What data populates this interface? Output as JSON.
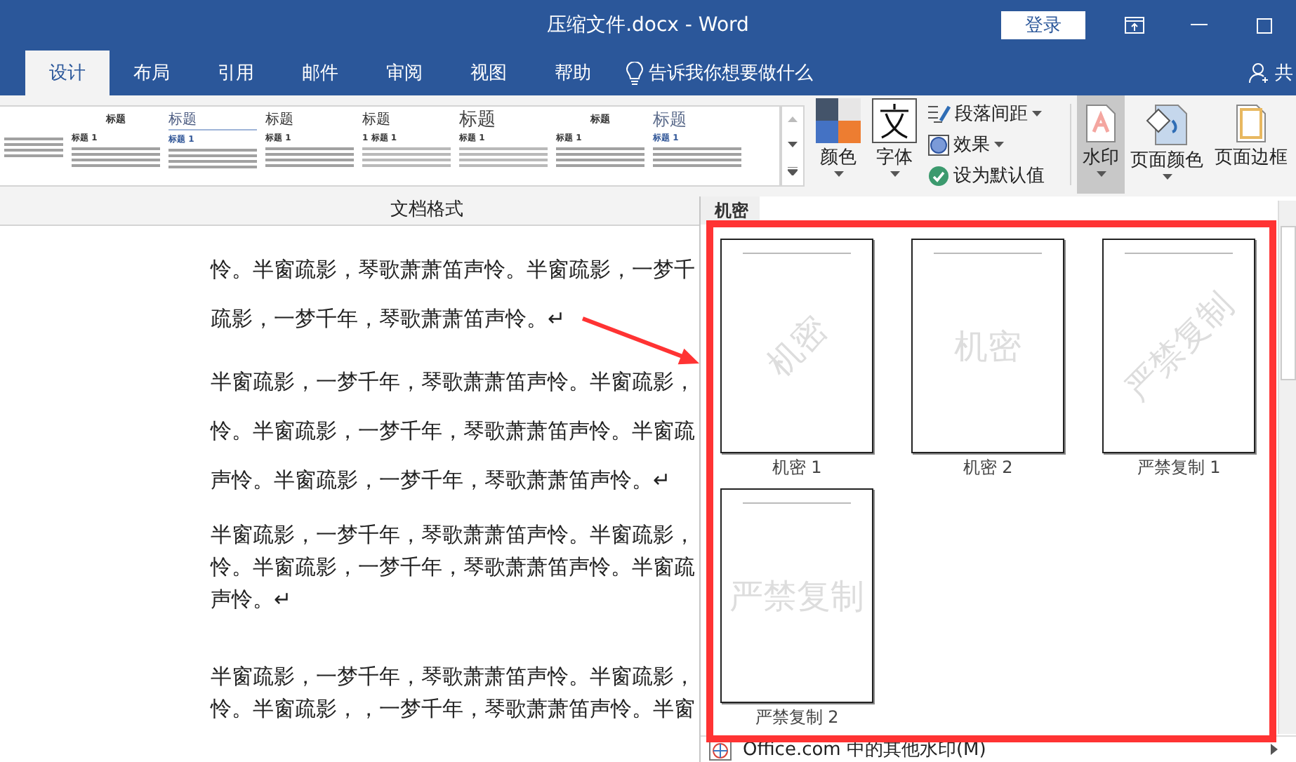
{
  "window": {
    "title": "压缩文件.docx  -  Word",
    "signin": "登录"
  },
  "tabs": [
    {
      "label": "设计",
      "selected": true
    },
    {
      "label": "布局",
      "selected": false
    },
    {
      "label": "引用",
      "selected": false
    },
    {
      "label": "邮件",
      "selected": false
    },
    {
      "label": "审阅",
      "selected": false
    },
    {
      "label": "视图",
      "selected": false
    },
    {
      "label": "帮助",
      "selected": false
    }
  ],
  "tell_me": "告诉我你想要做什么",
  "share": "共",
  "styles": [
    {
      "kind": "plain"
    },
    {
      "kind": "small",
      "title": "标题",
      "heading": "标题 1"
    },
    {
      "kind": "underline",
      "title": "标题",
      "heading": "标题 1"
    },
    {
      "kind": "plain",
      "title": "标题",
      "heading": "标题 1"
    },
    {
      "kind": "numbered",
      "title": "标题",
      "heading": "1  标题 1"
    },
    {
      "kind": "big",
      "title": "标题",
      "heading": "标题 1"
    },
    {
      "kind": "bold",
      "title": "标题",
      "heading": "标题 1"
    },
    {
      "kind": "blue",
      "title": "标题",
      "heading": "标题 1"
    }
  ],
  "ribbon": {
    "colors": "颜色",
    "fonts": "字体",
    "paragraph_spacing": "段落间距",
    "effects": "效果",
    "set_default": "设为默认值",
    "group_label": "文档格式",
    "page_buttons": [
      {
        "kind": "watermark",
        "label": "水印",
        "selected": true
      },
      {
        "kind": "page-color",
        "label": "页面颜色",
        "selected": false
      },
      {
        "kind": "page-border",
        "label": "页面边框",
        "selected": false
      }
    ]
  },
  "document": {
    "paragraphs": [
      {
        "kind": "wide",
        "lines": [
          "怜。半窗疏影，琴歌萧萧笛声怜。半窗疏影，一梦千",
          "疏影，一梦千年，琴歌萧萧笛声怜。↵"
        ]
      },
      {
        "kind": "wide",
        "lines": [
          "半窗疏影，一梦千年，琴歌萧萧笛声怜。半窗疏影，",
          "怜。半窗疏影，一梦千年，琴歌萧萧笛声怜。半窗疏",
          "声怜。半窗疏影，一梦千年，琴歌萧萧笛声怜。↵"
        ]
      },
      {
        "kind": "tight",
        "lines": [
          "半窗疏影，一梦千年，琴歌萧萧笛声怜。半窗疏影，",
          "怜。半窗疏影，一梦千年，琴歌萧萧笛声怜。半窗疏",
          "声怜。↵"
        ]
      },
      {
        "kind": "tight",
        "lines": [
          "半窗疏影，一梦千年，琴歌萧萧笛声怜。半窗疏影，",
          "怜。半窗疏影，，一梦千年，琴歌萧萧笛声怜。半窗"
        ]
      }
    ]
  },
  "watermark_menu": {
    "header": "机密",
    "items": [
      {
        "kind": "diagonal",
        "text": "机密",
        "label": "机密 1"
      },
      {
        "kind": "horizontal",
        "text": "机密",
        "label": "机密 2"
      },
      {
        "kind": "diagonal",
        "text": "严禁复制",
        "label": "严禁复制 1"
      },
      {
        "kind": "horizontal",
        "text": "严禁复制",
        "label": "严禁复制 2"
      }
    ],
    "more": "Office.com 中的其他水印(M)"
  }
}
